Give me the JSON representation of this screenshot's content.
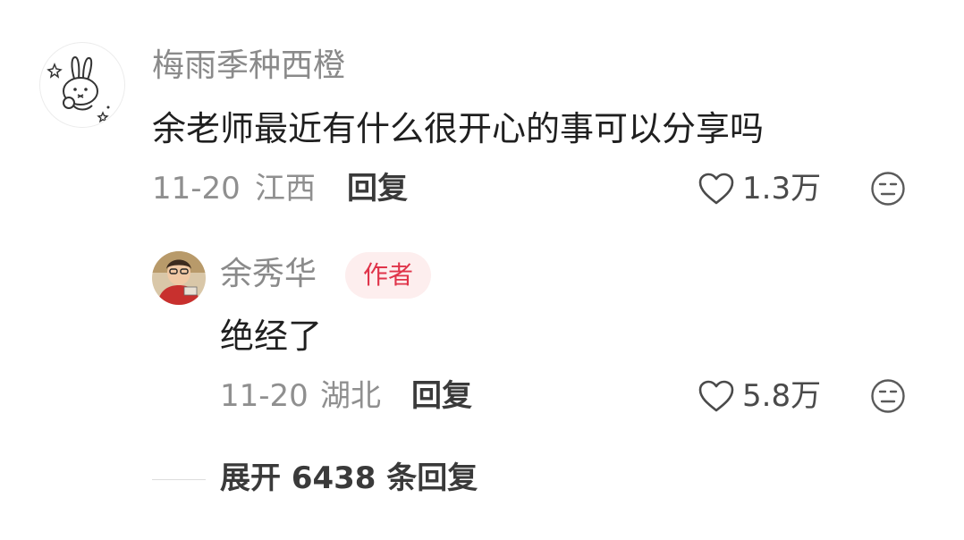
{
  "comment": {
    "username": "梅雨季种西橙",
    "text": "余老师最近有什么很开心的事可以分享吗",
    "date": "11-20",
    "location": "江西",
    "reply_label": "回复",
    "like_count": "1.3万",
    "avatar_icon": "bunny-icon"
  },
  "reply": {
    "username": "余秀华",
    "badge": "作者",
    "text": "绝经了",
    "date": "11-20",
    "location": "湖北",
    "reply_label": "回复",
    "like_count": "5.8万",
    "avatar_icon": "user-photo"
  },
  "expand_label": "展开 6438 条回复",
  "colors": {
    "badge_bg": "#fdeeee",
    "badge_text": "#e0344a",
    "muted_text": "#8a8a8a"
  }
}
